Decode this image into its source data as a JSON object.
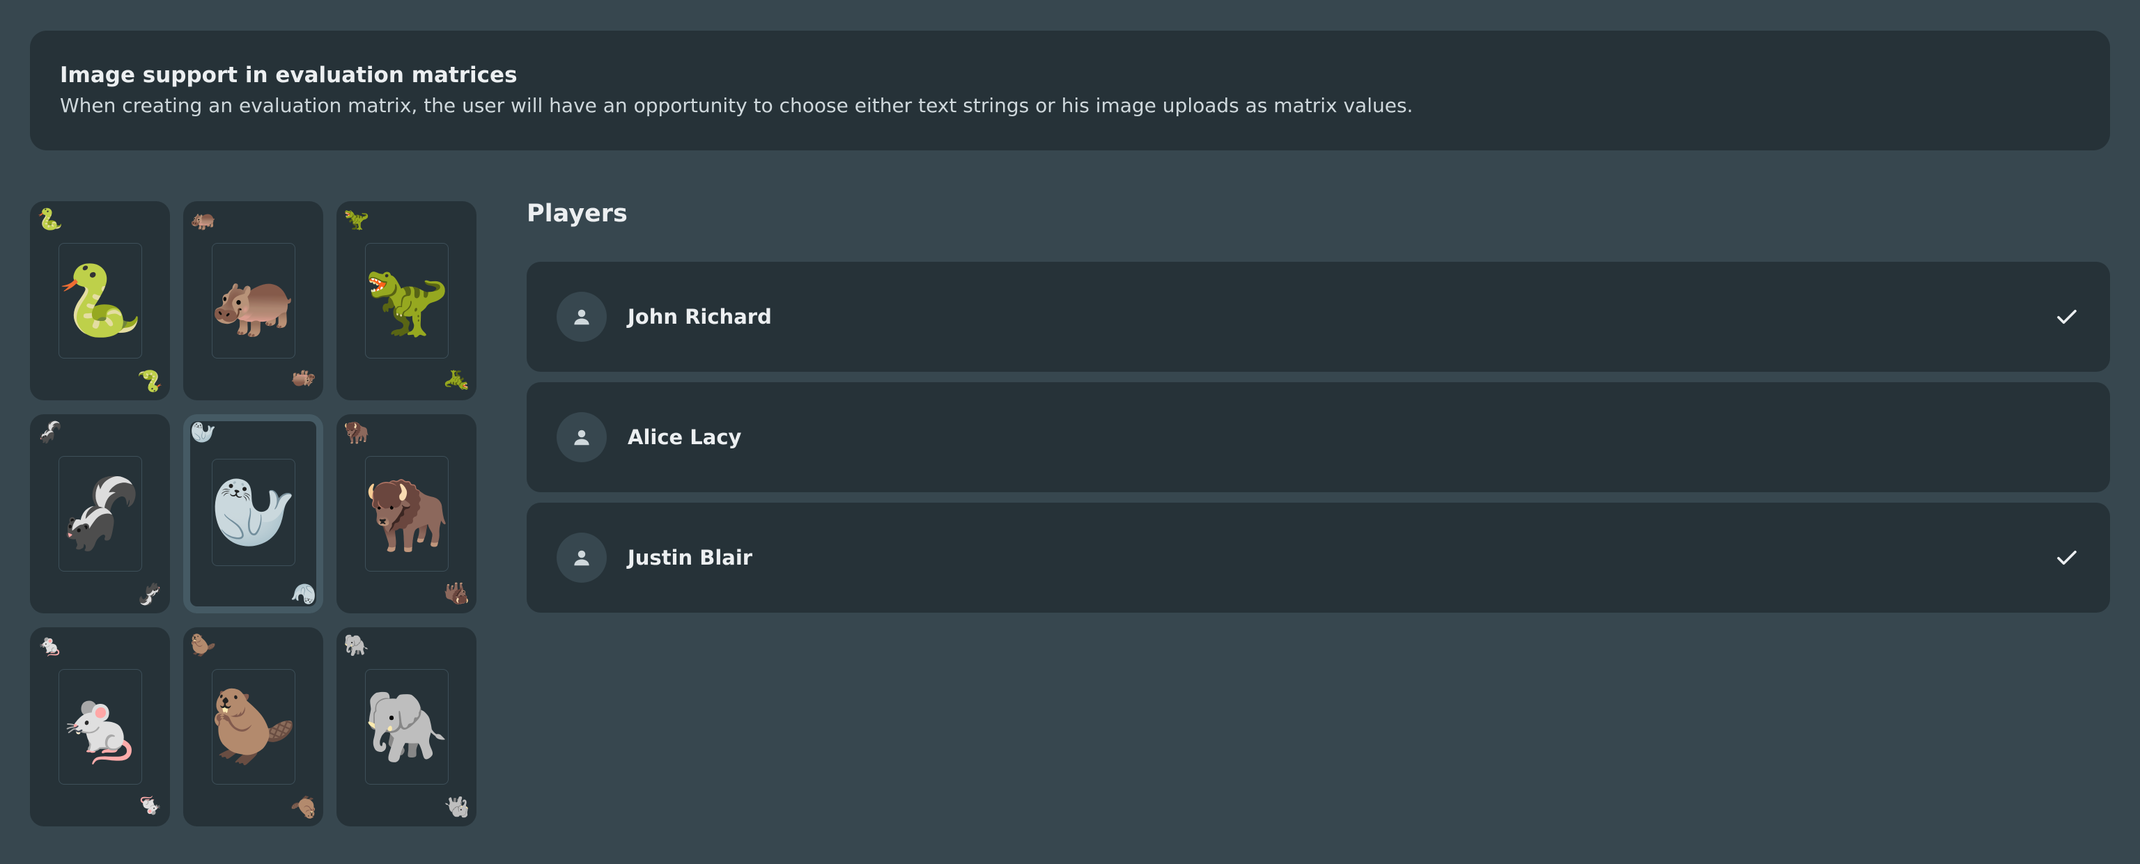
{
  "banner": {
    "title": "Image support in evaluation matrices",
    "description": "When creating an evaluation matrix, the user will have an opportunity to choose either text strings or his image uploads as matrix values."
  },
  "cards": [
    {
      "name": "snake",
      "emoji": "🐍",
      "selected": false
    },
    {
      "name": "hippopotamus",
      "emoji": "🦛",
      "selected": false
    },
    {
      "name": "t-rex",
      "emoji": "🦖",
      "selected": false
    },
    {
      "name": "skunk",
      "emoji": "🦨",
      "selected": false
    },
    {
      "name": "seal",
      "emoji": "🦭",
      "selected": true
    },
    {
      "name": "bison",
      "emoji": "🦬",
      "selected": false
    },
    {
      "name": "mouse",
      "emoji": "🐁",
      "selected": false
    },
    {
      "name": "beaver",
      "emoji": "🦫",
      "selected": false
    },
    {
      "name": "elephant",
      "emoji": "🐘",
      "selected": false
    }
  ],
  "players": {
    "title": "Players",
    "list": [
      {
        "name": "John Richard",
        "checked": true
      },
      {
        "name": "Alice Lacy",
        "checked": false
      },
      {
        "name": "Justin Blair",
        "checked": true
      }
    ]
  },
  "icons": {
    "avatar": "person-icon",
    "check": "check-icon"
  },
  "colors": {
    "background": "#37474f",
    "surface": "#263238",
    "accent": "#455a64",
    "text": "#eceff1"
  }
}
